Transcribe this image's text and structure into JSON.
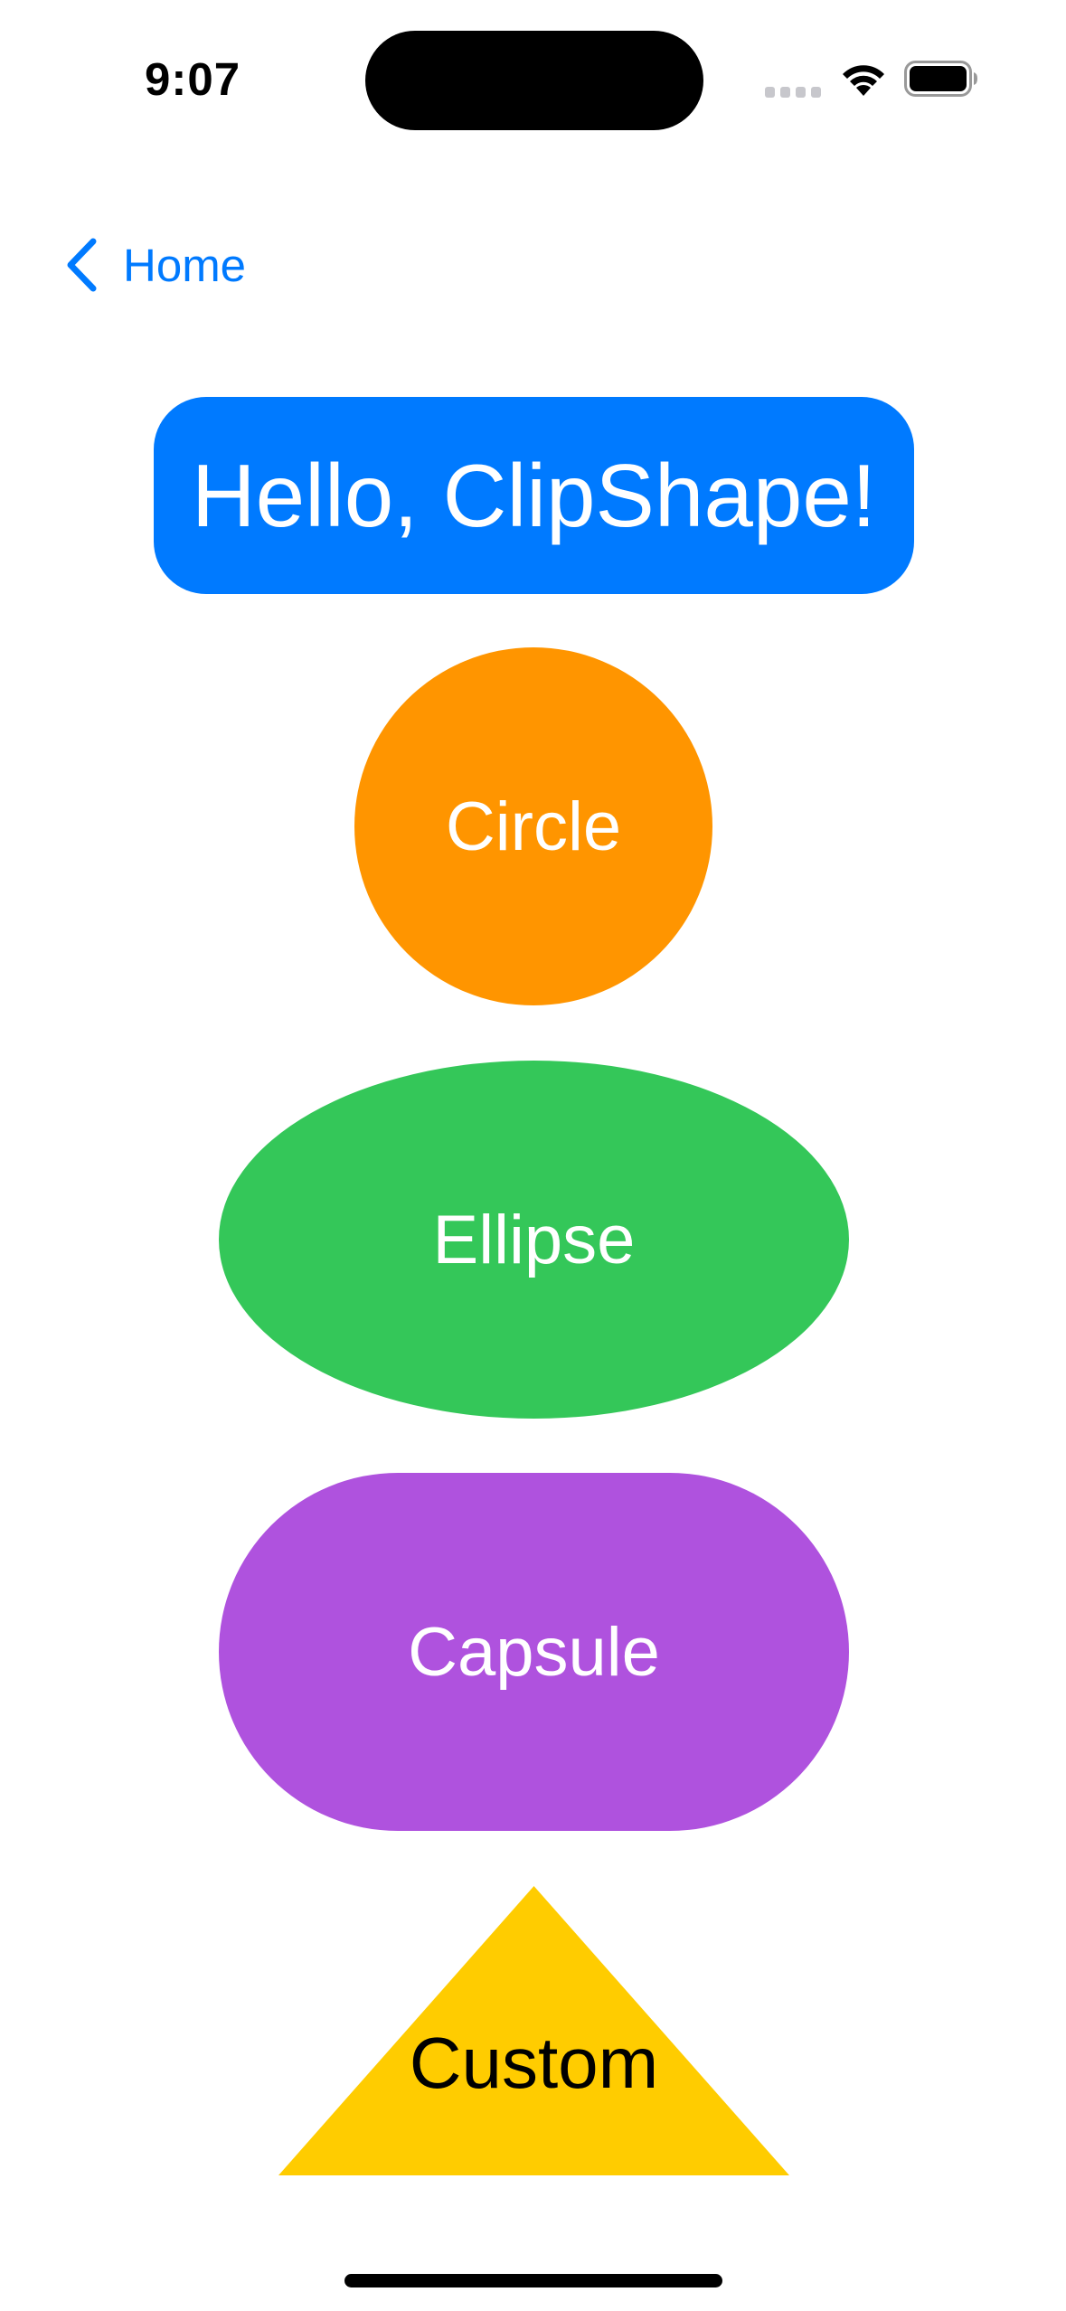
{
  "status_bar": {
    "time": "9:07"
  },
  "nav": {
    "back_label": "Home",
    "back_icon": "chevron-left-icon"
  },
  "shapes": {
    "hello": "Hello, ClipShape!",
    "circle": "Circle",
    "ellipse": "Ellipse",
    "capsule": "Capsule",
    "custom": "Custom"
  },
  "colors": {
    "accent": "#007aff",
    "circle": "#ff9500",
    "ellipse": "#34c759",
    "capsule": "#af52de",
    "custom": "#ffcc00"
  }
}
